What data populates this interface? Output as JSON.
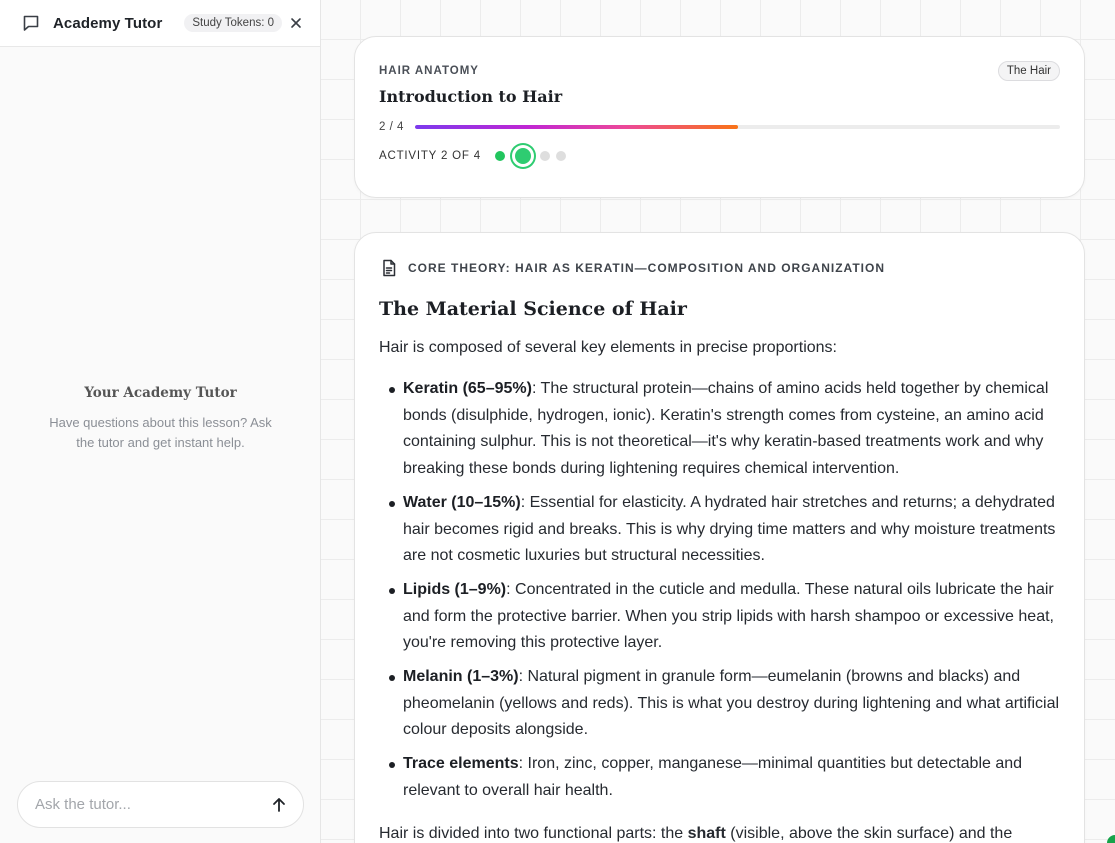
{
  "sidebar": {
    "title": "Academy Tutor",
    "tokens": "Study Tokens: 0",
    "empty_title": "Your Academy Tutor",
    "empty_desc": "Have questions about this lesson? Ask the tutor and get instant help.",
    "input_placeholder": "Ask the tutor..."
  },
  "lesson": {
    "eyebrow": "HAIR ANATOMY",
    "badge": "The Hair",
    "title": "Introduction to Hair",
    "progress_label": "2 / 4",
    "progress_fraction": 0.5,
    "activity_label": "ACTIVITY 2 OF 4",
    "activities_total": 4,
    "activity_current": 2
  },
  "content": {
    "section_label": "CORE THEORY: HAIR AS KERATIN—COMPOSITION AND ORGANIZATION",
    "title": "The Material Science of Hair",
    "intro": "Hair is composed of several key elements in precise proportions:",
    "bullets": [
      {
        "term": "Keratin (65–95%)",
        "text": ": The structural protein—chains of amino acids held together by chemical bonds (disulphide, hydrogen, ionic). Keratin's strength comes from cysteine, an amino acid containing sulphur. This is not theoretical—it's why keratin-based treatments work and why breaking these bonds during lightening requires chemical intervention."
      },
      {
        "term": "Water (10–15%)",
        "text": ": Essential for elasticity. A hydrated hair stretches and returns; a dehydrated hair becomes rigid and breaks. This is why drying time matters and why moisture treatments are not cosmetic luxuries but structural necessities."
      },
      {
        "term": "Lipids (1–9%)",
        "text": ": Concentrated in the cuticle and medulla. These natural oils lubricate the hair and form the protective barrier. When you strip lipids with harsh shampoo or excessive heat, you're removing this protective layer."
      },
      {
        "term": "Melanin (1–3%)",
        "text": ": Natural pigment in granule form—eumelanin (browns and blacks) and pheomelanin (yellows and reds). This is what you destroy during lightening and what artificial colour deposits alongside."
      },
      {
        "term": "Trace elements",
        "text": ": Iron, zinc, copper, manganese—minimal quantities but detectable and relevant to overall hair health."
      }
    ],
    "outro_start": "Hair is divided into two functional parts: the ",
    "outro_bold": "shaft",
    "outro_end": " (visible, above the skin surface) and the"
  },
  "colors": {
    "accent_green": "#2ecc71",
    "gradient": [
      "#7c3aed",
      "#c026d3",
      "#ec4899",
      "#f97316"
    ]
  }
}
